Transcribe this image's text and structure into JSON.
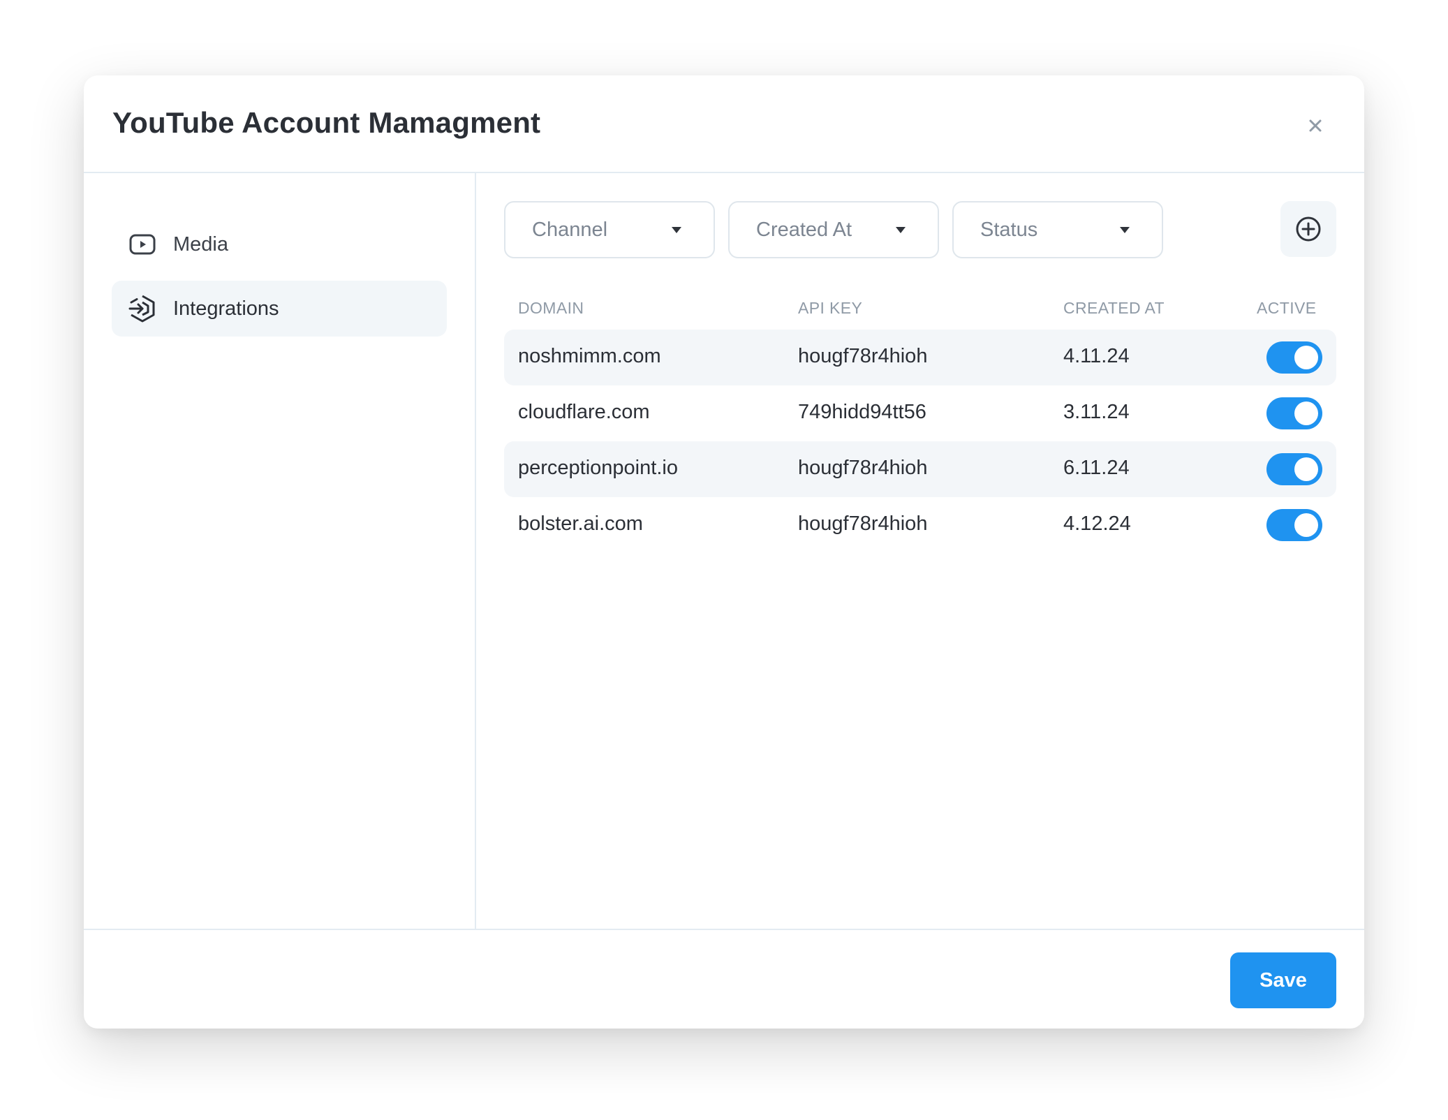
{
  "modal": {
    "title": "YouTube Account Mamagment",
    "close_icon": "close-icon"
  },
  "sidebar": {
    "items": [
      {
        "label": "Media",
        "icon": "youtube-play-icon",
        "active": false
      },
      {
        "label": "Integrations",
        "icon": "integrations-icon",
        "active": true
      }
    ]
  },
  "filters": {
    "channel": "Channel",
    "created_at": "Created At",
    "status": "Status",
    "add_icon": "plus-circle-icon"
  },
  "table": {
    "headers": {
      "domain": "DOMAIN",
      "api_key": "API KEY",
      "created_at": "CREATED AT",
      "active": "ACTIVE"
    },
    "rows": [
      {
        "domain": "noshmimm.com",
        "api_key": "hougf78r4hioh",
        "created_at": "4.11.24",
        "active": true
      },
      {
        "domain": "cloudflare.com",
        "api_key": "749hidd94tt56",
        "created_at": "3.11.24",
        "active": true
      },
      {
        "domain": "perceptionpoint.io",
        "api_key": "hougf78r4hioh",
        "created_at": "6.11.24",
        "active": true
      },
      {
        "domain": "bolster.ai.com",
        "api_key": "hougf78r4hioh",
        "created_at": "4.12.24",
        "active": true
      }
    ]
  },
  "footer": {
    "save_label": "Save"
  },
  "colors": {
    "accent": "#1f93f0",
    "active_nav_bg": "#f2f6f9",
    "row_alt_bg": "#f3f6f9"
  }
}
